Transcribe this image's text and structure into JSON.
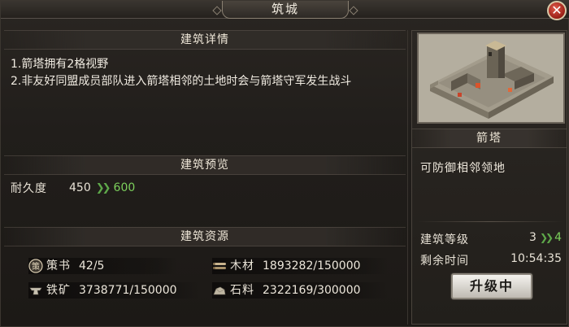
{
  "window": {
    "title": "筑城",
    "close_label": "✕"
  },
  "sections": {
    "details_title": "建筑详情",
    "preview_title": "建筑预览",
    "resources_title": "建筑资源"
  },
  "details": {
    "line1": "1.箭塔拥有2格视野",
    "line2": "2.非友好同盟成员部队进入箭塔相邻的土地时会与箭塔守军发生战斗"
  },
  "preview": {
    "label": "耐久度",
    "current": "450",
    "next": "600"
  },
  "resources": [
    {
      "name": "策书",
      "value": "42/5",
      "icon": "book-icon"
    },
    {
      "name": "木材",
      "value": "1893282/150000",
      "icon": "wood-icon"
    },
    {
      "name": "铁矿",
      "value": "3738771/150000",
      "icon": "iron-icon"
    },
    {
      "name": "石料",
      "value": "2322169/300000",
      "icon": "stone-icon"
    }
  ],
  "building": {
    "name": "箭塔",
    "description": "可防御相邻领地",
    "level_label": "建筑等级",
    "level_current": "3",
    "level_next": "4",
    "time_label": "剩余时间",
    "time_value": "10:54:35",
    "upgrade_button": "升级中"
  },
  "colors": {
    "accent_green": "#7ccf5c",
    "close_red": "#b8261a",
    "panel_bg": "#221f1b"
  }
}
